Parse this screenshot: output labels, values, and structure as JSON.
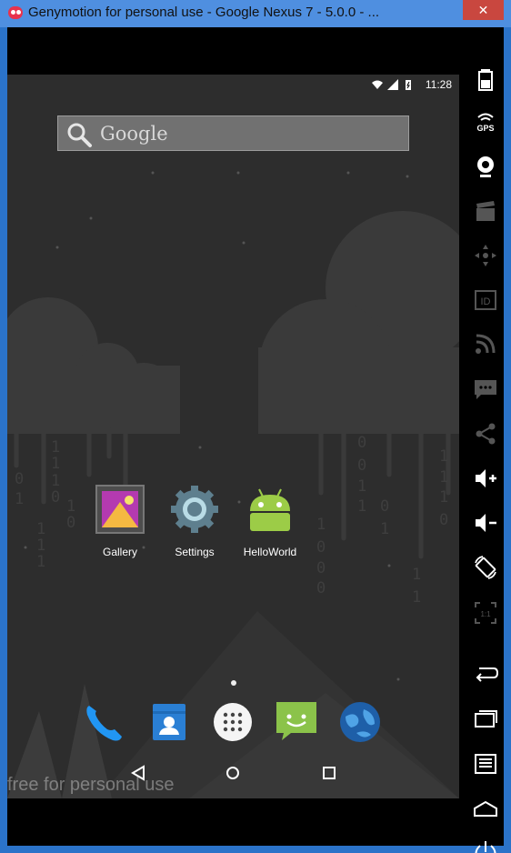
{
  "window": {
    "title": "Genymotion for personal use - Google Nexus 7 - 5.0.0 - ...",
    "close_glyph": "✕"
  },
  "statusbar": {
    "time": "11:28",
    "icons": [
      "wifi-icon",
      "signal-icon",
      "battery-icon"
    ]
  },
  "search": {
    "label": "Google"
  },
  "apps": [
    {
      "label": "Gallery",
      "icon": "gallery-icon"
    },
    {
      "label": "Settings",
      "icon": "settings-icon"
    },
    {
      "label": "HelloWorld",
      "icon": "android-icon"
    }
  ],
  "dock": [
    "phone-icon",
    "contacts-icon",
    "app-drawer-icon",
    "messaging-icon",
    "browser-icon"
  ],
  "navbar": [
    "back-icon",
    "home-icon",
    "recents-icon"
  ],
  "watermark": "free for personal use",
  "toolbar": [
    "battery-icon",
    "gps-icon",
    "webcam-icon",
    "media-icon",
    "dpad-icon",
    "id-icon",
    "rss-icon",
    "sms-icon",
    "share-icon",
    "volume-up-icon",
    "volume-down-icon",
    "rotate-icon",
    "pixel-perfect-icon",
    "back-icon",
    "recents-icon",
    "menu-icon",
    "home-icon",
    "power-icon"
  ],
  "toolbar_labels": {
    "gps": "GPS",
    "id": "ID",
    "pixel": "1:1"
  },
  "colors": {
    "titlebar": "#4f8fe0",
    "close": "#c9473f",
    "android_green": "#9ccc47",
    "toolbar_icon": "#ffffff"
  }
}
